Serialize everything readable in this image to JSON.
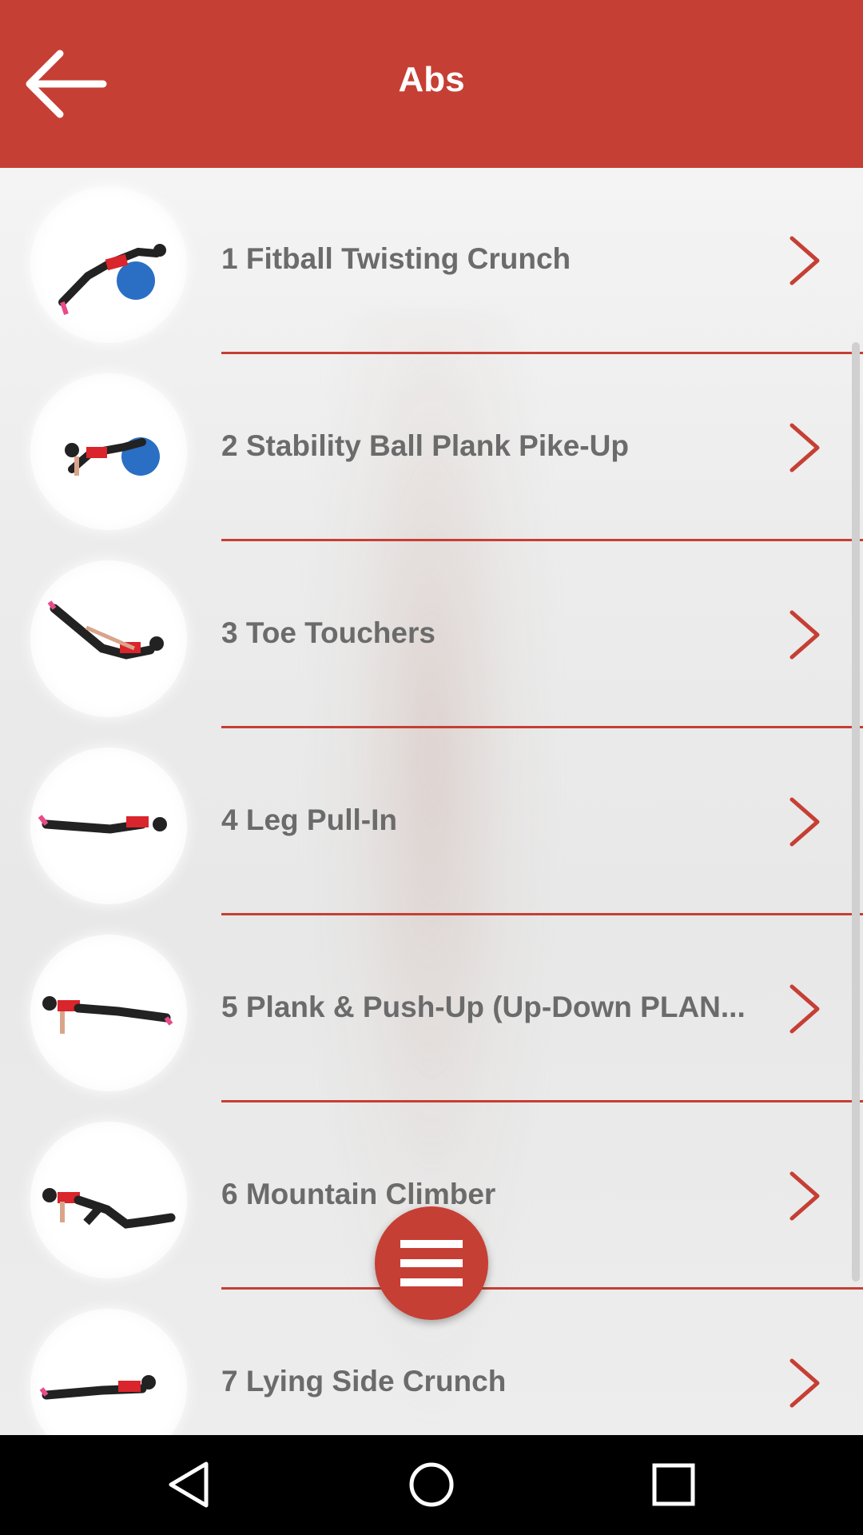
{
  "header": {
    "title": "Abs",
    "back_icon": "arrow-left-icon",
    "background": "#c63f34"
  },
  "exercises": [
    {
      "label": "1 Fitball Twisting Crunch",
      "thumbnail": "fitball-twisting-crunch",
      "action_icon": "chevron-right-icon"
    },
    {
      "label": "2 Stability Ball Plank Pike-Up",
      "thumbnail": "stability-ball-plank-pike-up",
      "action_icon": "chevron-right-icon"
    },
    {
      "label": "3 Toe Touchers",
      "thumbnail": "toe-touchers",
      "action_icon": "chevron-right-icon"
    },
    {
      "label": "4 Leg Pull-In",
      "thumbnail": "leg-pull-in",
      "action_icon": "chevron-right-icon"
    },
    {
      "label": "5 Plank & Push-Up (Up-Down PLAN...",
      "thumbnail": "plank-push-up",
      "action_icon": "chevron-right-icon"
    },
    {
      "label": "6 Mountain Climber",
      "thumbnail": "mountain-climber",
      "action_icon": "chevron-right-icon"
    },
    {
      "label": "7 Lying Side Crunch",
      "thumbnail": "lying-side-crunch",
      "action_icon": "chevron-right-icon"
    }
  ],
  "fab": {
    "icon": "menu-icon"
  },
  "navigation_bar": {
    "buttons": [
      "back-triangle-icon",
      "home-circle-icon",
      "recents-square-icon"
    ]
  },
  "colors": {
    "accent": "#c63f34",
    "text": "#6b6b6b",
    "nav_background": "#000000"
  }
}
